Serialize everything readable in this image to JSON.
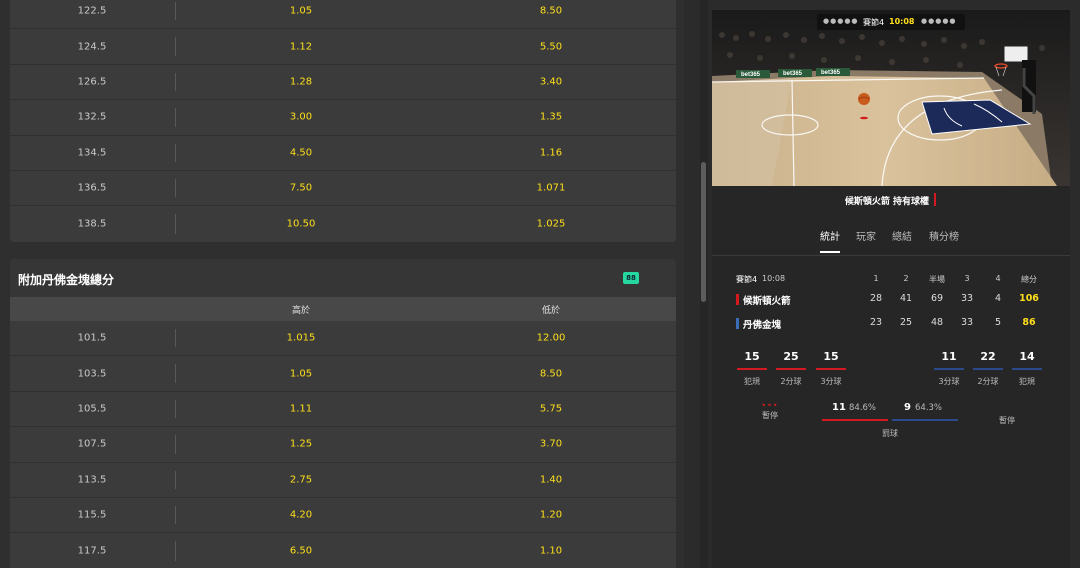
{
  "market1": {
    "rows": [
      {
        "line": "122.5",
        "over": "1.05",
        "under": "8.50"
      },
      {
        "line": "124.5",
        "over": "1.12",
        "under": "5.50"
      },
      {
        "line": "126.5",
        "over": "1.28",
        "under": "3.40"
      },
      {
        "line": "132.5",
        "over": "3.00",
        "under": "1.35"
      },
      {
        "line": "134.5",
        "over": "4.50",
        "under": "1.16"
      },
      {
        "line": "136.5",
        "over": "7.50",
        "under": "1.071"
      },
      {
        "line": "138.5",
        "over": "10.50",
        "under": "1.025"
      }
    ]
  },
  "market2": {
    "title": "附加丹佛金塊總分",
    "badge": "88",
    "col_over": "高於",
    "col_under": "低於",
    "rows": [
      {
        "line": "101.5",
        "over": "1.015",
        "under": "12.00"
      },
      {
        "line": "103.5",
        "over": "1.05",
        "under": "8.50"
      },
      {
        "line": "105.5",
        "over": "1.11",
        "under": "5.75"
      },
      {
        "line": "107.5",
        "over": "1.25",
        "under": "3.70"
      },
      {
        "line": "113.5",
        "over": "2.75",
        "under": "1.40"
      },
      {
        "line": "115.5",
        "over": "4.20",
        "under": "1.20"
      },
      {
        "line": "117.5",
        "over": "6.50",
        "under": "1.10"
      }
    ]
  },
  "live": {
    "scoreboard": {
      "period": "賽節4",
      "clock": "10:08"
    },
    "ad_boards": [
      "bet365",
      "bet365",
      "bet365"
    ],
    "possession": "候斯頓火箭 持有球權"
  },
  "tabs": [
    "統計",
    "玩家",
    "總結",
    "積分榜"
  ],
  "stats": {
    "period": "賽節4",
    "clock": "10:08",
    "headers": [
      "1",
      "2",
      "半場",
      "3",
      "4",
      "總分"
    ],
    "home": {
      "name": "候斯頓火箭",
      "color": "#d41a1f",
      "scores": [
        "28",
        "41",
        "69",
        "33",
        "4"
      ],
      "total": "106"
    },
    "away": {
      "name": "丹佛金塊",
      "color": "#3a6fb8",
      "scores": [
        "23",
        "25",
        "48",
        "33",
        "5"
      ],
      "total": "86"
    },
    "home_stats": [
      {
        "value": "15",
        "label": "犯規"
      },
      {
        "value": "25",
        "label": "2分球"
      },
      {
        "value": "15",
        "label": "3分球"
      }
    ],
    "away_stats": [
      {
        "value": "11",
        "label": "3分球"
      },
      {
        "value": "22",
        "label": "2分球"
      },
      {
        "value": "14",
        "label": "犯規"
      }
    ],
    "timeouts_label": "暫停",
    "timeouts_home_dots": "•••",
    "free_throws": {
      "label": "罰球",
      "home_value": "11",
      "home_pct": "84.6%",
      "away_value": "9",
      "away_pct": "64.3%"
    }
  }
}
